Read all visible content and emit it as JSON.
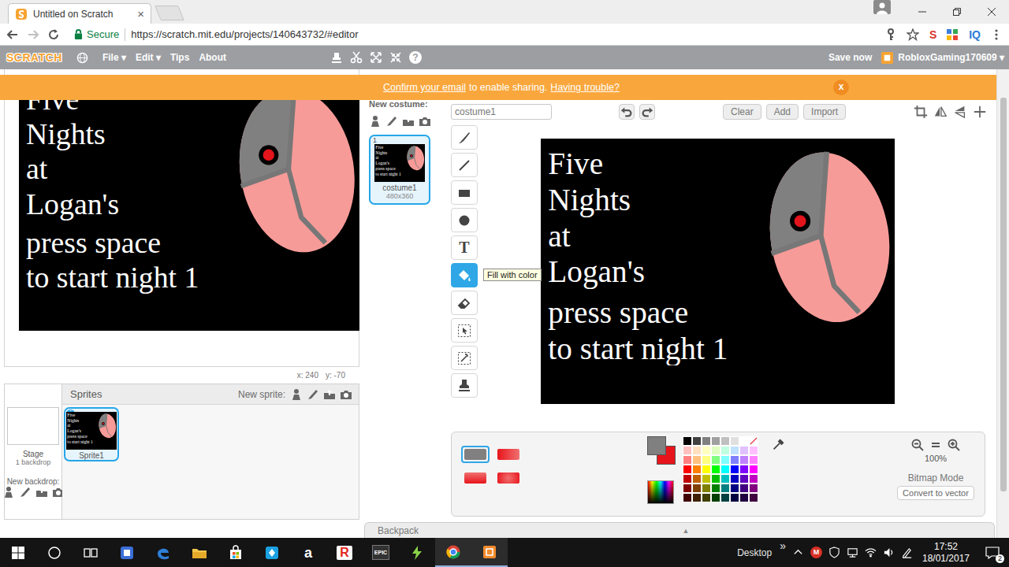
{
  "browser": {
    "tabs": [
      {
        "label": "Untitled on Scratch",
        "close": "×",
        "selected": true
      }
    ],
    "security": "Secure",
    "url": "https://scratch.mit.edu/projects/140643732/#editor",
    "extensions": [
      {
        "label": "S",
        "color": "#d8322a"
      },
      {
        "label": "IQ",
        "color": "#2a7ad8"
      }
    ]
  },
  "menu_bar": {
    "logo": "SCRATCH",
    "items": [
      "File ▾",
      "Edit ▾",
      "Tips",
      "About"
    ],
    "help": "?",
    "save": "Save now",
    "user": "RobloxGaming170609 ▾"
  },
  "banner": {
    "link": "Confirm your email",
    "text": "to enable sharing.",
    "help": "Having trouble?",
    "close": "x"
  },
  "stage": {
    "coords": [
      "x: 240",
      "y: -70"
    ]
  },
  "artwork": {
    "title_lines": [
      "Five",
      "Nights",
      "at",
      "Logan's"
    ],
    "prompt_lines": [
      "press space",
      "to start night 1"
    ]
  },
  "sprites": {
    "title": "Sprites",
    "new_sprite": "New sprite:",
    "stage": {
      "label": "Stage",
      "backdrops": "1 backdrop",
      "new_backdrop": "New backdrop:"
    },
    "items": [
      {
        "name": "Sprite1",
        "info": "i",
        "selected": true
      }
    ]
  },
  "costumes": {
    "new_costume": "New costume:",
    "items": [
      {
        "number": "1",
        "name": "costume1",
        "size": "480x360",
        "selected": true
      }
    ]
  },
  "paint_editor": {
    "name": "costume1",
    "buttons": [
      "Clear",
      "Add",
      "Import"
    ],
    "tools": [
      {
        "kind": "brush",
        "selected": false
      },
      {
        "kind": "line",
        "selected": false
      },
      {
        "kind": "rectangle",
        "selected": false
      },
      {
        "kind": "ellipse",
        "selected": false
      },
      {
        "kind": "text",
        "glyph": "T",
        "selected": false
      },
      {
        "kind": "fill",
        "selected": true
      },
      {
        "kind": "eraser",
        "selected": false
      },
      {
        "kind": "select",
        "selected": false
      },
      {
        "kind": "magic-select",
        "selected": false
      },
      {
        "kind": "stamp",
        "selected": false
      }
    ],
    "tooltip": "Fill with color",
    "fill_modes": [
      {
        "kind": "solid",
        "selected": true
      },
      {
        "kind": "horizontal",
        "selected": false
      },
      {
        "kind": "vertical",
        "selected": false
      },
      {
        "kind": "radial",
        "selected": false
      }
    ],
    "primary_color": "#808080",
    "secondary_color": "#e8141b",
    "palette": [
      "#000000",
      "#404040",
      "#808080",
      "#a0a0a0",
      "#c0c0c0",
      "#e0e0e0",
      "#ffffff",
      "#ffc0c0",
      "#ffe0c0",
      "#ffffc0",
      "#e0ffc0",
      "#c0ffe0",
      "#c0e0ff",
      "#e0c0ff",
      "#ffc0ff",
      "#ff8080",
      "#ffc080",
      "#ffff80",
      "#80ff80",
      "#80ffff",
      "#8080ff",
      "#c080ff",
      "#ff80ff",
      "#ff0000",
      "#ff8000",
      "#ffff00",
      "#00ff00",
      "#00ffff",
      "#0000ff",
      "#8000ff",
      "#ff00ff",
      "#c00000",
      "#c06000",
      "#c0c000",
      "#00c000",
      "#00c0c0",
      "#0000c0",
      "#6000c0",
      "#c000c0",
      "#800000",
      "#804000",
      "#808000",
      "#008000",
      "#008080",
      "#000080",
      "#400080",
      "#800080",
      "#400000",
      "#402000",
      "#404000",
      "#004000",
      "#004040",
      "#000040",
      "#200040",
      "#400040"
    ],
    "zoom": "100%",
    "mode": "Bitmap Mode",
    "convert": "Convert to vector"
  },
  "backpack": {
    "label": "Backpack",
    "arrow": "▲"
  },
  "taskbar": {
    "apps": [
      {
        "kind": "start",
        "active": false
      },
      {
        "kind": "search",
        "active": false
      },
      {
        "kind": "task-view",
        "active": false
      },
      {
        "kind": "app-blue",
        "active": false
      },
      {
        "kind": "edge",
        "active": false
      },
      {
        "kind": "explorer",
        "active": false
      },
      {
        "kind": "store",
        "active": false
      },
      {
        "kind": "app-cyan",
        "active": false
      },
      {
        "kind": "amazon",
        "label": "a",
        "active": false
      },
      {
        "kind": "roblox",
        "label": "R",
        "active": false
      },
      {
        "kind": "epic",
        "label": "EPIC",
        "active": false
      },
      {
        "kind": "bolt",
        "active": false
      },
      {
        "kind": "chrome",
        "active": true
      },
      {
        "kind": "scratch",
        "active": true
      }
    ],
    "desktop": "Desktop",
    "overflow": "»",
    "tray": [
      {
        "kind": "chevron"
      },
      {
        "kind": "letter",
        "label": "M"
      },
      {
        "kind": "shield"
      },
      {
        "kind": "network"
      },
      {
        "kind": "wifi"
      },
      {
        "kind": "volume"
      },
      {
        "kind": "pen"
      }
    ],
    "time": "17:52",
    "date": "18/01/2017",
    "notifications": "2"
  }
}
